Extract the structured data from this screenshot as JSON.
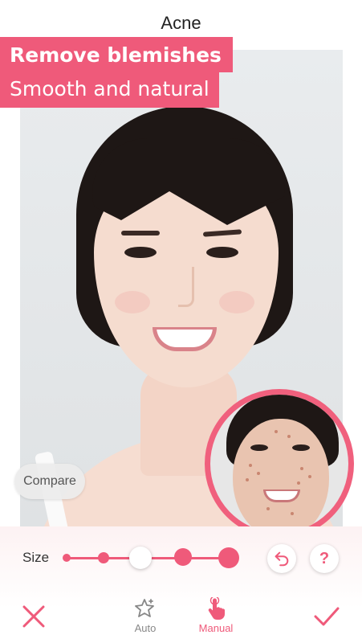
{
  "header": {
    "title": "Acne"
  },
  "promo": {
    "line1": "Remove blemishes",
    "line2": "Smooth and natural"
  },
  "image": {
    "compare_label": "Compare",
    "before_inset": "before-image-inset"
  },
  "size_control": {
    "label": "Size",
    "options": 5,
    "selected_index": 2
  },
  "actions": {
    "undo_icon": "undo-icon",
    "help_label": "?"
  },
  "toolbar": {
    "cancel_icon": "close-icon",
    "confirm_icon": "check-icon",
    "modes": [
      {
        "label": "Auto",
        "icon": "magic-star-icon",
        "active": false
      },
      {
        "label": "Manual",
        "icon": "hand-tap-icon",
        "active": true
      }
    ]
  },
  "colors": {
    "accent": "#ef5a7a",
    "text": "#222222",
    "muted": "#888888"
  }
}
